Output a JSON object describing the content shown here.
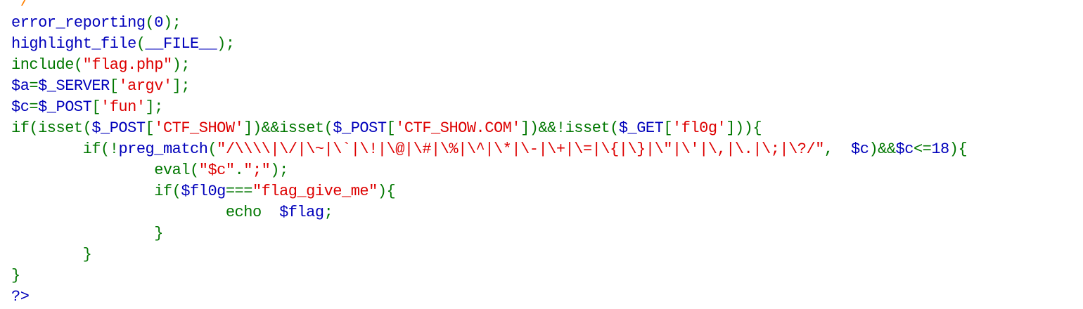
{
  "colors": {
    "keyword": "#007700",
    "default": "#0000BB",
    "string": "#DD0000",
    "comment": "#FF8000",
    "background": "#FFFFFF"
  },
  "lines": [
    [
      {
        "t": "*/",
        "c": "comment"
      }
    ],
    [
      {
        "t": "error_reporting",
        "c": "default"
      },
      {
        "t": "(",
        "c": "keyword"
      },
      {
        "t": "0",
        "c": "default"
      },
      {
        "t": ");",
        "c": "keyword"
      }
    ],
    [
      {
        "t": "highlight_file",
        "c": "default"
      },
      {
        "t": "(",
        "c": "keyword"
      },
      {
        "t": "__FILE__",
        "c": "default"
      },
      {
        "t": ");",
        "c": "keyword"
      }
    ],
    [
      {
        "t": "include(",
        "c": "keyword"
      },
      {
        "t": "\"flag.php\"",
        "c": "string"
      },
      {
        "t": ");",
        "c": "keyword"
      }
    ],
    [
      {
        "t": "$a",
        "c": "default"
      },
      {
        "t": "=",
        "c": "keyword"
      },
      {
        "t": "$_SERVER",
        "c": "default"
      },
      {
        "t": "[",
        "c": "keyword"
      },
      {
        "t": "'argv'",
        "c": "string"
      },
      {
        "t": "];",
        "c": "keyword"
      }
    ],
    [
      {
        "t": "$c",
        "c": "default"
      },
      {
        "t": "=",
        "c": "keyword"
      },
      {
        "t": "$_POST",
        "c": "default"
      },
      {
        "t": "[",
        "c": "keyword"
      },
      {
        "t": "'fun'",
        "c": "string"
      },
      {
        "t": "];",
        "c": "keyword"
      }
    ],
    [
      {
        "t": "if(isset(",
        "c": "keyword"
      },
      {
        "t": "$_POST",
        "c": "default"
      },
      {
        "t": "[",
        "c": "keyword"
      },
      {
        "t": "'CTF_SHOW'",
        "c": "string"
      },
      {
        "t": "])&&isset(",
        "c": "keyword"
      },
      {
        "t": "$_POST",
        "c": "default"
      },
      {
        "t": "[",
        "c": "keyword"
      },
      {
        "t": "'CTF_SHOW.COM'",
        "c": "string"
      },
      {
        "t": "])&&!isset(",
        "c": "keyword"
      },
      {
        "t": "$_GET",
        "c": "default"
      },
      {
        "t": "[",
        "c": "keyword"
      },
      {
        "t": "'fl0g'",
        "c": "string"
      },
      {
        "t": "])){",
        "c": "keyword"
      }
    ],
    [
      {
        "t": "        if(!",
        "c": "keyword"
      },
      {
        "t": "preg_match",
        "c": "default"
      },
      {
        "t": "(",
        "c": "keyword"
      },
      {
        "t": "\"/\\\\\\\\|\\/|\\~|\\`|\\!|\\@|\\#|\\%|\\^|\\*|\\-|\\+|\\=|\\{|\\}|\\\"|\\'|\\,|\\.|\\;|\\?/\"",
        "c": "string"
      },
      {
        "t": ",  ",
        "c": "keyword"
      },
      {
        "t": "$c",
        "c": "default"
      },
      {
        "t": ")&&",
        "c": "keyword"
      },
      {
        "t": "$c",
        "c": "default"
      },
      {
        "t": "<=",
        "c": "keyword"
      },
      {
        "t": "18",
        "c": "default"
      },
      {
        "t": "){",
        "c": "keyword"
      }
    ],
    [
      {
        "t": "                eval(",
        "c": "keyword"
      },
      {
        "t": "\"$c\"",
        "c": "string"
      },
      {
        "t": ".",
        "c": "keyword"
      },
      {
        "t": "\";\"",
        "c": "string"
      },
      {
        "t": ");",
        "c": "keyword"
      }
    ],
    [
      {
        "t": "                if(",
        "c": "keyword"
      },
      {
        "t": "$fl0g",
        "c": "default"
      },
      {
        "t": "===",
        "c": "keyword"
      },
      {
        "t": "\"flag_give_me\"",
        "c": "string"
      },
      {
        "t": "){",
        "c": "keyword"
      }
    ],
    [
      {
        "t": "                        echo  ",
        "c": "keyword"
      },
      {
        "t": "$flag",
        "c": "default"
      },
      {
        "t": ";",
        "c": "keyword"
      }
    ],
    [
      {
        "t": "                }",
        "c": "keyword"
      }
    ],
    [
      {
        "t": "        }",
        "c": "keyword"
      }
    ],
    [
      {
        "t": "}",
        "c": "keyword"
      }
    ],
    [
      {
        "t": "?>",
        "c": "default"
      }
    ]
  ]
}
